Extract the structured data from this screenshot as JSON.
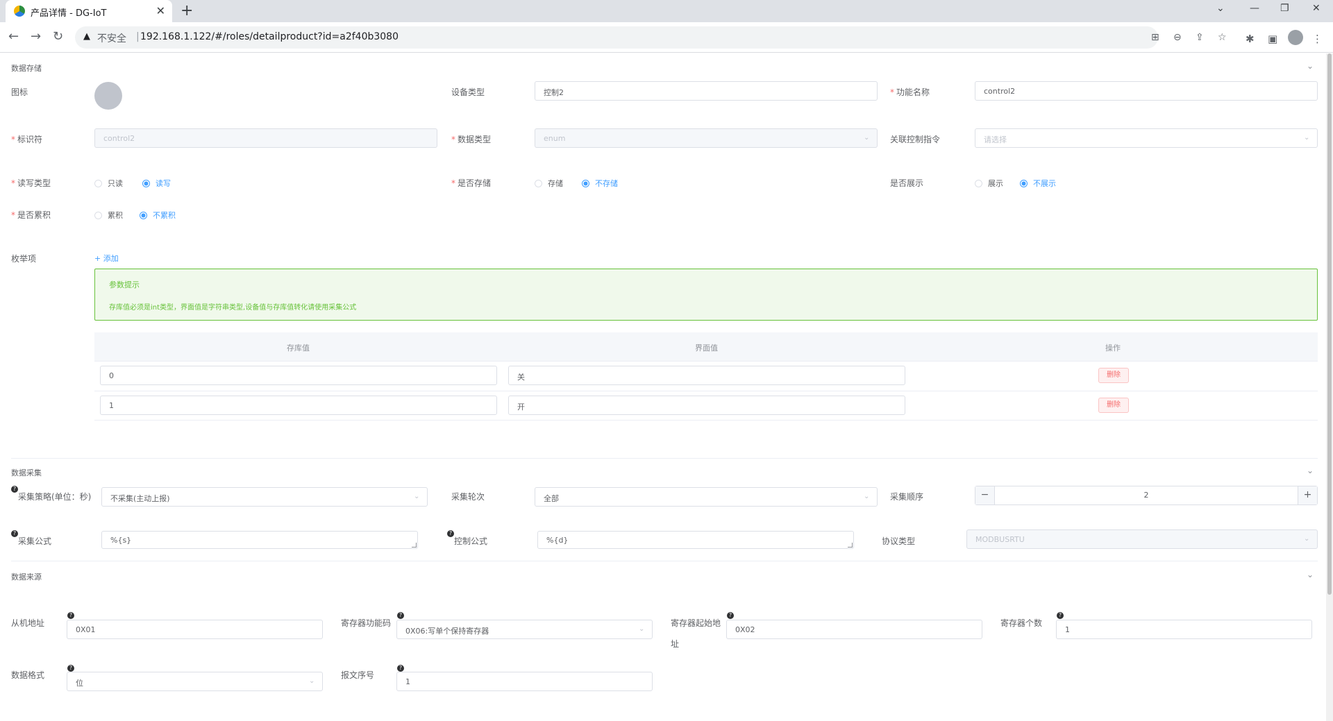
{
  "browser": {
    "tab_title": "产品详情 - DG-IoT",
    "insecure": "不安全",
    "url": "192.168.1.122/#/roles/detailproduct?id=a2f40b3080"
  },
  "storage": {
    "title": "数据存储",
    "icon_label": "图标",
    "device_type_label": "设备类型",
    "device_type_value": "控制2",
    "func_name_label": "功能名称",
    "func_name_value": "control2",
    "identifier_label": "标识符",
    "identifier_value": "control2",
    "data_type_label": "数据类型",
    "data_type_value": "enum",
    "ctrl_cmd_label": "关联控制指令",
    "ctrl_cmd_placeholder": "请选择",
    "rw_label": "读写类型",
    "rw_options": [
      "只读",
      "读写"
    ],
    "store_label": "是否存储",
    "store_options": [
      "存储",
      "不存储"
    ],
    "show_label": "是否展示",
    "show_options": [
      "展示",
      "不展示"
    ],
    "accum_label": "是否累积",
    "accum_options": [
      "累积",
      "不累积"
    ],
    "enum_label": "枚举项",
    "add_label": "+ 添加",
    "alert_title": "参数提示",
    "alert_desc": "存库值必须是int类型，界面值是字符串类型,设备值与存库值转化请使用采集公式",
    "table_headers": [
      "存库值",
      "界面值",
      "操作"
    ],
    "rows": [
      {
        "store": "0",
        "ui": "关",
        "action": "删除"
      },
      {
        "store": "1",
        "ui": "开",
        "action": "删除"
      }
    ]
  },
  "collect": {
    "title": "数据采集",
    "strategy_label": "采集策略(单位：秒)",
    "strategy_value": "不采集(主动上报)",
    "round_label": "采集轮次",
    "round_value": "全部",
    "order_label": "采集顺序",
    "order_value": "2",
    "formula_label": "采集公式",
    "formula_value": "%{s}",
    "ctrl_formula_label": "控制公式",
    "ctrl_formula_value": "%{d}",
    "protocol_label": "协议类型",
    "protocol_value": "MODBUSRTU"
  },
  "source": {
    "title": "数据来源",
    "slave_label": "从机地址",
    "slave_value": "0X01",
    "func_code_label": "寄存器功能码",
    "func_code_value": "0X06:写单个保持寄存器",
    "reg_start_label_1": "寄存器起始地",
    "reg_start_label_2": "址",
    "reg_start_value": "0X02",
    "reg_count_label": "寄存器个数",
    "reg_count_value": "1",
    "data_format_label": "数据格式",
    "data_format_value": "位",
    "msg_seq_label": "报文序号",
    "msg_seq_value": "1"
  }
}
